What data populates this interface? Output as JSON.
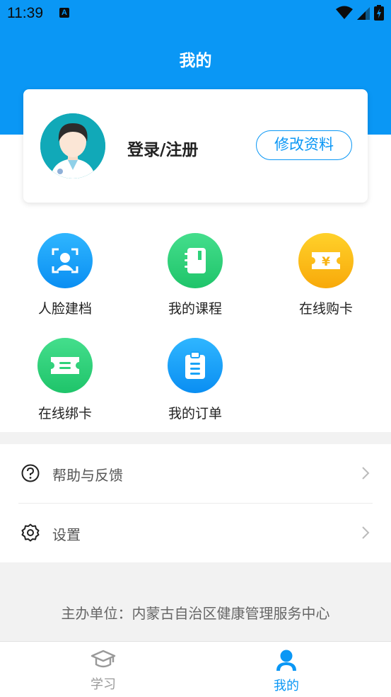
{
  "status_bar": {
    "time": "11:39",
    "notification_letter": "A"
  },
  "header": {
    "title": "我的"
  },
  "profile": {
    "login_label": "登录/注册",
    "edit_button": "修改资料"
  },
  "grid": {
    "items": [
      {
        "label": "人脸建档",
        "icon": "face-scan-icon",
        "color": "#1aa3f7"
      },
      {
        "label": "我的课程",
        "icon": "notebook-icon",
        "color": "#2ed17a"
      },
      {
        "label": "在线购卡",
        "icon": "yen-ticket-icon",
        "color": "#fcbc17"
      },
      {
        "label": "在线绑卡",
        "icon": "ticket-icon",
        "color": "#2ed17a"
      },
      {
        "label": "我的订单",
        "icon": "clipboard-icon",
        "color": "#1aa3f7"
      }
    ]
  },
  "menu": {
    "items": [
      {
        "label": "帮助与反馈",
        "icon": "help-icon"
      },
      {
        "label": "设置",
        "icon": "settings-icon"
      }
    ]
  },
  "footer": {
    "text": "主办单位：内蒙古自治区健康管理服务中心"
  },
  "tabbar": {
    "tabs": [
      {
        "label": "学习",
        "icon": "graduation-cap-icon",
        "active": false
      },
      {
        "label": "我的",
        "icon": "person-icon",
        "active": true
      }
    ]
  },
  "colors": {
    "accent": "#0a97f5",
    "inactive_tab": "#999999"
  }
}
